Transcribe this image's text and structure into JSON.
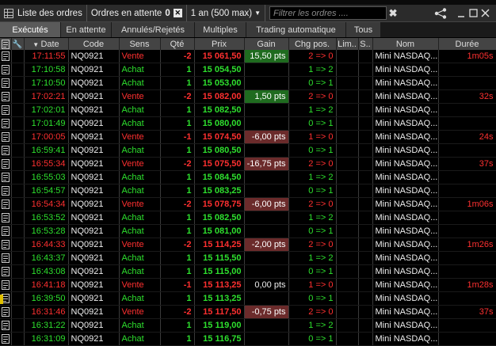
{
  "header": {
    "orders_list": "Liste des ordres",
    "pending_label": "Ordres en attente",
    "pending_count": "0",
    "period": "1 an (500 max)",
    "filter_placeholder": "Filtrer les ordres ...."
  },
  "tabs": [
    {
      "label": "Exécutés",
      "active": true
    },
    {
      "label": "En attente"
    },
    {
      "label": "Annulés/Rejetés"
    },
    {
      "label": "Multiples"
    },
    {
      "label": "Trading automatique"
    },
    {
      "label": "Tous"
    }
  ],
  "columns": {
    "date": "Date",
    "code": "Code",
    "sens": "Sens",
    "qte": "Qté",
    "prix": "Prix",
    "gain": "Gain",
    "chg": "Chg pos.",
    "lim": "Lim..",
    "s": "S..",
    "nom": "Nom",
    "duree": "Durée"
  },
  "colors": {
    "buy": "#2ee02e",
    "sell": "#ff3030",
    "gain_positive_bg": "#1f6b1f",
    "gain_negative_bg": "#6b2b2b"
  },
  "rows": [
    {
      "date": "17:11:55",
      "code": "NQ0921",
      "sens": "Vente",
      "qte": "-2",
      "prix": "15 061,50",
      "gain": "15,50 pts",
      "chg": "2 => 0",
      "nom": "Mini NASDAQ...",
      "duree": "1m05s"
    },
    {
      "date": "17:10:58",
      "code": "NQ0921",
      "sens": "Achat",
      "qte": "1",
      "prix": "15 054,50",
      "gain": "",
      "chg": "1 => 2",
      "nom": "Mini NASDAQ...",
      "duree": ""
    },
    {
      "date": "17:10:50",
      "code": "NQ0921",
      "sens": "Achat",
      "qte": "1",
      "prix": "15 053,00",
      "gain": "",
      "chg": "0 => 1",
      "nom": "Mini NASDAQ...",
      "duree": ""
    },
    {
      "date": "17:02:21",
      "code": "NQ0921",
      "sens": "Vente",
      "qte": "-2",
      "prix": "15 082,00",
      "gain": "1,50 pts",
      "chg": "2 => 0",
      "nom": "Mini NASDAQ...",
      "duree": "32s"
    },
    {
      "date": "17:02:01",
      "code": "NQ0921",
      "sens": "Achat",
      "qte": "1",
      "prix": "15 082,50",
      "gain": "",
      "chg": "1 => 2",
      "nom": "Mini NASDAQ...",
      "duree": ""
    },
    {
      "date": "17:01:49",
      "code": "NQ0921",
      "sens": "Achat",
      "qte": "1",
      "prix": "15 080,00",
      "gain": "",
      "chg": "0 => 1",
      "nom": "Mini NASDAQ...",
      "duree": ""
    },
    {
      "date": "17:00:05",
      "code": "NQ0921",
      "sens": "Vente",
      "qte": "-1",
      "prix": "15 074,50",
      "gain": "-6,00 pts",
      "chg": "1 => 0",
      "nom": "Mini NASDAQ...",
      "duree": "24s"
    },
    {
      "date": "16:59:41",
      "code": "NQ0921",
      "sens": "Achat",
      "qte": "1",
      "prix": "15 080,50",
      "gain": "",
      "chg": "0 => 1",
      "nom": "Mini NASDAQ...",
      "duree": ""
    },
    {
      "date": "16:55:34",
      "code": "NQ0921",
      "sens": "Vente",
      "qte": "-2",
      "prix": "15 075,50",
      "gain": "-16,75 pts",
      "chg": "2 => 0",
      "nom": "Mini NASDAQ...",
      "duree": "37s"
    },
    {
      "date": "16:55:03",
      "code": "NQ0921",
      "sens": "Achat",
      "qte": "1",
      "prix": "15 084,50",
      "gain": "",
      "chg": "1 => 2",
      "nom": "Mini NASDAQ...",
      "duree": ""
    },
    {
      "date": "16:54:57",
      "code": "NQ0921",
      "sens": "Achat",
      "qte": "1",
      "prix": "15 083,25",
      "gain": "",
      "chg": "0 => 1",
      "nom": "Mini NASDAQ...",
      "duree": ""
    },
    {
      "date": "16:54:34",
      "code": "NQ0921",
      "sens": "Vente",
      "qte": "-2",
      "prix": "15 078,75",
      "gain": "-6,00 pts",
      "chg": "2 => 0",
      "nom": "Mini NASDAQ...",
      "duree": "1m06s"
    },
    {
      "date": "16:53:52",
      "code": "NQ0921",
      "sens": "Achat",
      "qte": "1",
      "prix": "15 082,50",
      "gain": "",
      "chg": "1 => 2",
      "nom": "Mini NASDAQ...",
      "duree": ""
    },
    {
      "date": "16:53:28",
      "code": "NQ0921",
      "sens": "Achat",
      "qte": "1",
      "prix": "15 081,00",
      "gain": "",
      "chg": "0 => 1",
      "nom": "Mini NASDAQ...",
      "duree": ""
    },
    {
      "date": "16:44:33",
      "code": "NQ0921",
      "sens": "Vente",
      "qte": "-2",
      "prix": "15 114,25",
      "gain": "-2,00 pts",
      "chg": "2 => 0",
      "nom": "Mini NASDAQ...",
      "duree": "1m26s"
    },
    {
      "date": "16:43:37",
      "code": "NQ0921",
      "sens": "Achat",
      "qte": "1",
      "prix": "15 115,50",
      "gain": "",
      "chg": "1 => 2",
      "nom": "Mini NASDAQ...",
      "duree": ""
    },
    {
      "date": "16:43:08",
      "code": "NQ0921",
      "sens": "Achat",
      "qte": "1",
      "prix": "15 115,00",
      "gain": "",
      "chg": "0 => 1",
      "nom": "Mini NASDAQ...",
      "duree": ""
    },
    {
      "date": "16:41:18",
      "code": "NQ0921",
      "sens": "Vente",
      "qte": "-1",
      "prix": "15 113,25",
      "gain": "0,00 pts",
      "chg": "1 => 0",
      "nom": "Mini NASDAQ...",
      "duree": "1m28s"
    },
    {
      "date": "16:39:50",
      "code": "NQ0921",
      "sens": "Achat",
      "qte": "1",
      "prix": "15 113,25",
      "gain": "",
      "chg": "0 => 1",
      "nom": "Mini NASDAQ...",
      "duree": ""
    },
    {
      "date": "16:31:46",
      "code": "NQ0921",
      "sens": "Vente",
      "qte": "-2",
      "prix": "15 117,50",
      "gain": "-0,75 pts",
      "chg": "2 => 0",
      "nom": "Mini NASDAQ...",
      "duree": "37s"
    },
    {
      "date": "16:31:22",
      "code": "NQ0921",
      "sens": "Achat",
      "qte": "1",
      "prix": "15 119,00",
      "gain": "",
      "chg": "1 => 2",
      "nom": "Mini NASDAQ...",
      "duree": ""
    },
    {
      "date": "16:31:09",
      "code": "NQ0921",
      "sens": "Achat",
      "qte": "1",
      "prix": "15 116,75",
      "gain": "",
      "chg": "0 => 1",
      "nom": "Mini NASDAQ...",
      "duree": ""
    }
  ]
}
